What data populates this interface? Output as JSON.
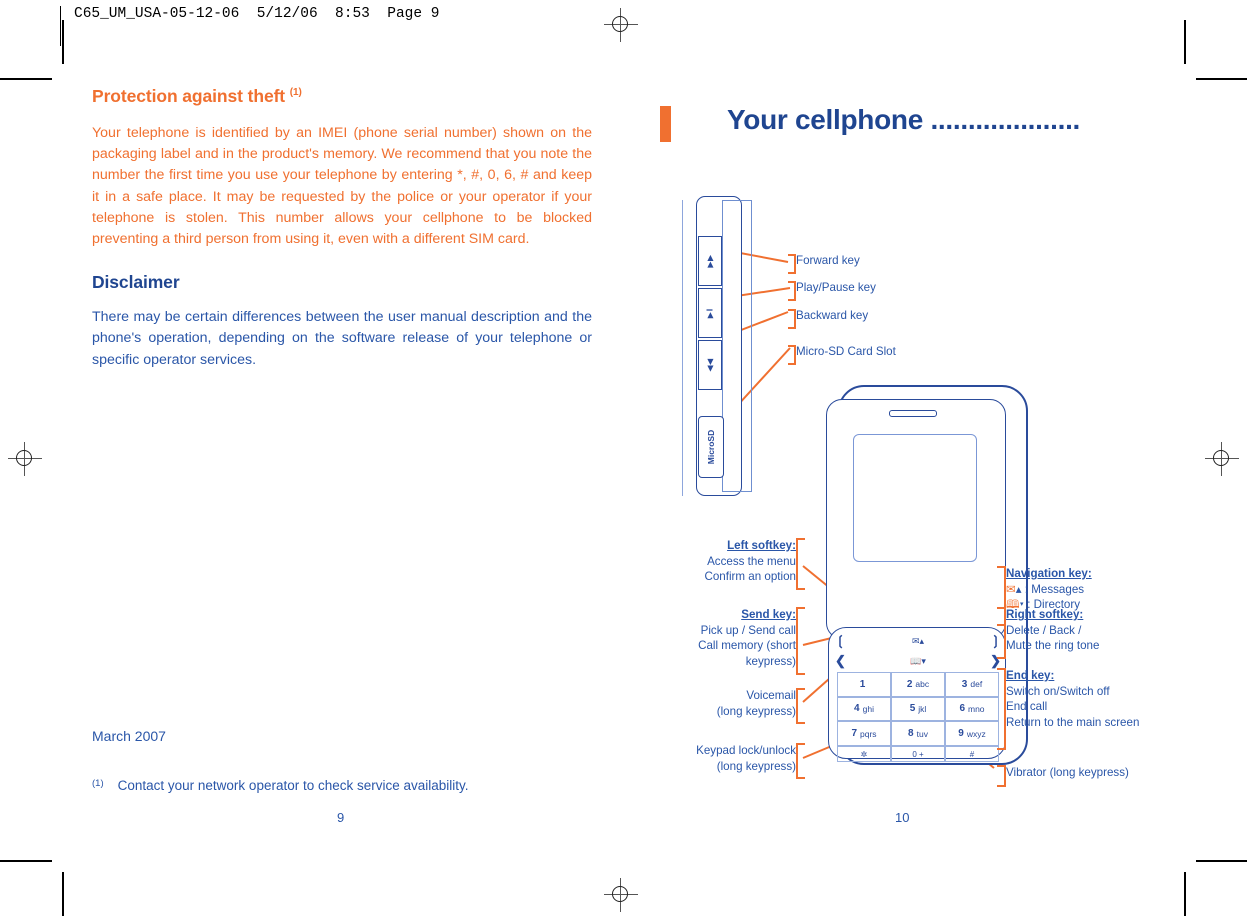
{
  "printer": {
    "running_head": "C65_UM_USA-05-12-06  5/12/06  8:53  Page 9"
  },
  "left_page": {
    "section1": {
      "heading": "Protection against theft",
      "heading_footnote_mark": "(1)",
      "body": "Your telephone is identified by an IMEI (phone serial number) shown on the packaging label and in the product's memory. We recommend that you note the number the first time you use your telephone by entering  *, #, 0, 6, # and keep it in a safe place. It may be requested by the police or your operator if your telephone is stolen. This number allows your cellphone to be blocked preventing a third person from using it, even with a different SIM card."
    },
    "section2": {
      "heading": "Disclaimer",
      "body": "There may be certain differences between the user manual description and the phone's operation, depending on the software release of your telephone or specific operator services."
    },
    "date": "March 2007",
    "footnote": {
      "mark": "(1)",
      "text": "Contact your network operator to check service availability."
    },
    "page_number": "9"
  },
  "right_page": {
    "chapter_title": "Your cellphone ....................",
    "page_number": "10",
    "side_view": {
      "keys": [
        {
          "name": "forward-key",
          "glyph": "▶▶"
        },
        {
          "name": "play-pause-key",
          "glyph": "▶‖"
        },
        {
          "name": "backward-key",
          "glyph": "◀◀"
        }
      ],
      "sd_slot_label": "MicroSD"
    },
    "side_labels": [
      {
        "id": "forward-key",
        "text": "Forward key"
      },
      {
        "id": "play-pause-key",
        "text": "Play/Pause key"
      },
      {
        "id": "backward-key",
        "text": "Backward key"
      },
      {
        "id": "micro-sd-card-slot",
        "text": "Micro-SD Card Slot"
      }
    ],
    "callouts_left": [
      {
        "id": "left-softkey",
        "title": "Left softkey:",
        "lines": [
          "Access the menu",
          "Confirm an option"
        ]
      },
      {
        "id": "send-key",
        "title": "Send key:",
        "lines": [
          "Pick up / Send call",
          "Call memory (short",
          "keypress)"
        ]
      },
      {
        "id": "voicemail",
        "title": "",
        "lines": [
          "Voicemail",
          "(long keypress)"
        ]
      },
      {
        "id": "keypad-lock",
        "title": "",
        "lines": [
          "Keypad lock/unlock",
          "(long keypress)"
        ]
      }
    ],
    "callouts_right": [
      {
        "id": "navigation-key",
        "title": "Navigation key:",
        "icon_lines": [
          {
            "icon": "envelope-icon",
            "arrow": "▲",
            "text": ": Messages"
          },
          {
            "icon": "book-icon",
            "arrow": "▼",
            "text": ": Directory"
          }
        ],
        "lines": []
      },
      {
        "id": "right-softkey",
        "title": "Right softkey:",
        "lines": [
          "Delete / Back /",
          "Mute the ring tone"
        ]
      },
      {
        "id": "end-key",
        "title": "End key:",
        "lines": [
          "Switch on/Switch off",
          "End call",
          "Return to the main screen"
        ]
      },
      {
        "id": "vibrator",
        "title": "",
        "lines": [
          "Vibrator (long keypress)"
        ]
      }
    ],
    "keypad": {
      "rows": [
        [
          {
            "num": "1",
            "letters": ""
          },
          {
            "num": "2",
            "letters": "abc"
          },
          {
            "num": "3",
            "letters": "def"
          }
        ],
        [
          {
            "num": "4",
            "letters": "ghi"
          },
          {
            "num": "5",
            "letters": "jkl"
          },
          {
            "num": "6",
            "letters": "mno"
          }
        ],
        [
          {
            "num": "7",
            "letters": "pqrs"
          },
          {
            "num": "8",
            "letters": "tuv"
          },
          {
            "num": "9",
            "letters": "wxyz"
          }
        ]
      ],
      "bottom_row": [
        {
          "icon": "lock-icon",
          "label": "✲"
        },
        {
          "icon": "zero-key",
          "label": "0 +"
        },
        {
          "icon": "hash-key",
          "label": "#"
        }
      ]
    }
  },
  "colors": {
    "orange": "#f07030",
    "blue_dark": "#1f4590",
    "blue_text": "#2a56a8",
    "blue_line": "#2a4b9b"
  }
}
